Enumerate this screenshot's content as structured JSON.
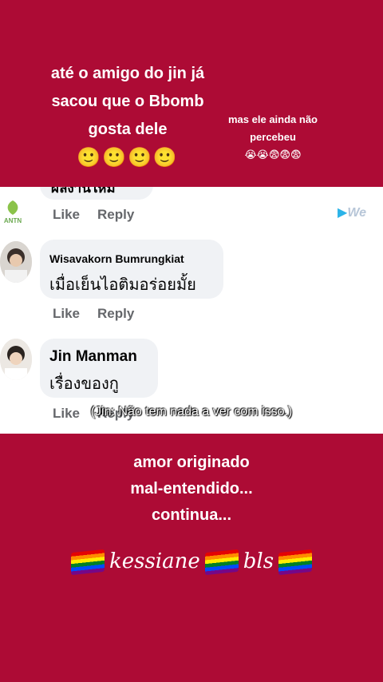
{
  "story": {
    "top_left": {
      "lines": [
        "até o amigo do jin já",
        "sacou que o Bbomb",
        "gosta dele"
      ],
      "emoji": "🙂🙂🙂🙂"
    },
    "top_right": {
      "lines": [
        "mas ele ainda não",
        "percebeu"
      ],
      "emoji": "😭😭😨😨😨"
    },
    "bottom": {
      "lines": [
        "amor originado",
        "mal-entendido...",
        "continua..."
      ]
    },
    "credit": [
      "kessiane",
      "bls"
    ]
  },
  "facebook": {
    "partial_comment": {
      "text": "ผลงานใหม่",
      "actions": [
        "Like",
        "Reply"
      ]
    },
    "logo_text": "ANTN",
    "watermark": "We",
    "comments": [
      {
        "author": "Wisavakorn Bumrungkiat",
        "text": "เมื่อเย็นไอติมอร่อยมั้ย",
        "actions": [
          "Like",
          "Reply"
        ]
      },
      {
        "author": "Jin Manman",
        "text": "เรื่องของกู",
        "actions": [
          "Like",
          "Reply"
        ]
      }
    ],
    "subtitle": "(Jin: Não tem nada a ver com isso.)"
  }
}
